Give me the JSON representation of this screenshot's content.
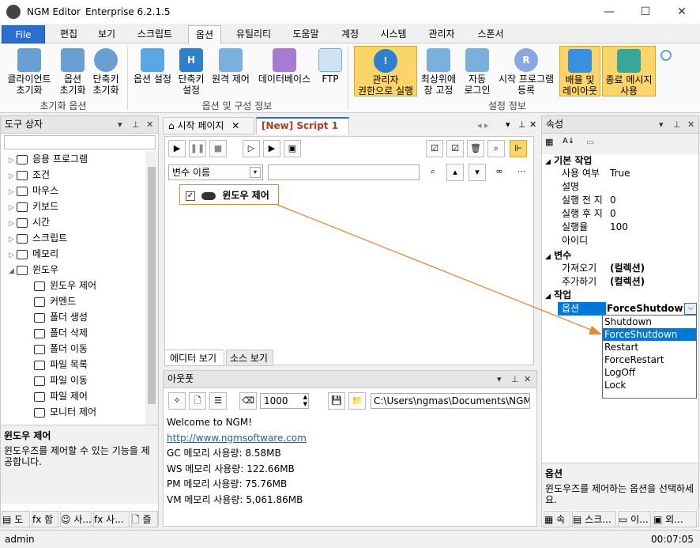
{
  "titlebar": {
    "app": "NGM Editor",
    "edition": "Enterprise 6.2.1.5",
    "min": "—",
    "max": "☐",
    "close": "✕"
  },
  "menu": [
    "File",
    "편집",
    "보기",
    "스크립트",
    "옵션",
    "유틸리티",
    "도움말",
    "계정",
    "시스템",
    "관리자",
    "스폰서"
  ],
  "ribbon": {
    "buttons": [
      "클라이언트\n초기화",
      "옵션\n초기화",
      "단축키\n초기화",
      "옵션 설정",
      "단축키\n설정",
      "원격 제어",
      "데이터베이스",
      "FTP",
      "관리자\n권한으로 실행",
      "최상위에\n창 고정",
      "자동\n로그인",
      "시작 프로그램\n등록",
      "배율 및\n레이아웃",
      "종료 메시지\n사용"
    ],
    "groups": [
      "초기화 옵션",
      "옵션 및 구성 정보",
      "설정 정보"
    ]
  },
  "toolbox": {
    "title": "도구 상자",
    "items": [
      "응용 프로그램",
      "조건",
      "마우스",
      "키보드",
      "시간",
      "스크립트",
      "메모리",
      "윈도우"
    ],
    "children": [
      "윈도우 제어",
      "커멘드",
      "폴더 생성",
      "폴더 삭제",
      "폴더 이동",
      "파일 목록",
      "파일 이동",
      "파일 제어",
      "모니터 제어"
    ],
    "desc_title": "윈도우 제어",
    "desc_text": "윈도우즈를 제어할 수 있는 기능을 제공합니다.",
    "tabs": [
      "도",
      "함",
      "사...",
      "사...",
      "즐"
    ]
  },
  "editor": {
    "tabs": [
      "시작 페이지",
      "[New] Script 1"
    ],
    "var_dropdown": "변수 이름",
    "script_item": "윈도우 제어",
    "bottom_tabs": [
      "에디터 보기",
      "소스 보기"
    ]
  },
  "output": {
    "title": "아웃풋",
    "number": "1000",
    "path": "C:\\Users\\ngmas\\Documents\\NGM6\\",
    "lines": [
      "Welcome to NGM!",
      "http://www.ngmsoftware.com",
      "GC 메모리 사용량: 8.58MB",
      "WS 메모리 사용량: 122.66MB",
      "PM 메모리 사용량: 75.76MB",
      "VM 메모리 사용량: 5,061.86MB"
    ]
  },
  "properties": {
    "title": "속성",
    "cat_basic": "기본 작업",
    "rows_basic": [
      [
        "사용 여부",
        "True"
      ],
      [
        "설명",
        ""
      ],
      [
        "실행 전 지",
        "0"
      ],
      [
        "실행 후 지",
        "0"
      ],
      [
        "실행율",
        "100"
      ],
      [
        "아이디",
        ""
      ]
    ],
    "cat_var": "변수",
    "rows_var": [
      [
        "가져오기",
        "(컬렉션)"
      ],
      [
        "추가하기",
        "(컬렉션)"
      ]
    ],
    "cat_work": "작업",
    "option_key": "옵션",
    "option_value": "ForceShutdown",
    "dropdown": [
      "Shutdown",
      "ForceShutdown",
      "Restart",
      "ForceRestart",
      "LogOff",
      "Lock"
    ],
    "desc_title": "옵션",
    "desc_text": "윈도우즈를 제어하는 옵션을 선택하세요.",
    "tabs": [
      "속",
      "스크...",
      "이...",
      "외..."
    ]
  },
  "status": {
    "user": "admin",
    "time": "00:07:05"
  },
  "colors": {
    "accent": "#2a6ecf",
    "highlight": "#fbd46a",
    "annotation": "#e08a3a",
    "selected": "#0078d7"
  }
}
